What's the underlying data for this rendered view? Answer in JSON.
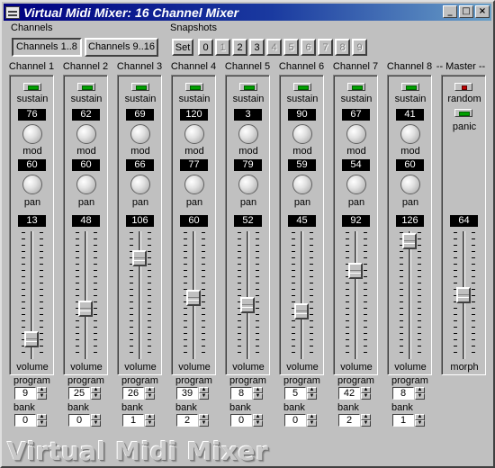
{
  "window": {
    "title": "Virtual Midi Mixer: 16 Channel Mixer",
    "minimize_glyph": "_",
    "maximize_glyph": "□",
    "close_glyph": "×"
  },
  "channels_group": {
    "label": "Channels",
    "buttons": [
      "Channels 1..8",
      "Channels 9..16"
    ]
  },
  "snapshots_group": {
    "label": "Snapshots",
    "set_label": "Set",
    "buttons": [
      "0",
      "1",
      "2",
      "3",
      "4",
      "5",
      "6",
      "7",
      "8",
      "9"
    ],
    "enabled": [
      true,
      false,
      true,
      true,
      false,
      false,
      false,
      false,
      false,
      false
    ]
  },
  "strip_labels": {
    "sustain": "sustain",
    "mod": "mod",
    "pan": "pan",
    "volume": "volume",
    "program": "program",
    "bank": "bank"
  },
  "channels": [
    {
      "name": "Channel 1",
      "sustain_val": "76",
      "mod_val": "60",
      "pan_val": "13",
      "volume": 13,
      "program": "9",
      "bank": "0"
    },
    {
      "name": "Channel 2",
      "sustain_val": "62",
      "mod_val": "60",
      "pan_val": "48",
      "volume": 48,
      "program": "25",
      "bank": "0"
    },
    {
      "name": "Channel 3",
      "sustain_val": "69",
      "mod_val": "66",
      "pan_val": "106",
      "volume": 106,
      "program": "26",
      "bank": "1"
    },
    {
      "name": "Channel 4",
      "sustain_val": "120",
      "mod_val": "77",
      "pan_val": "60",
      "volume": 60,
      "program": "39",
      "bank": "2"
    },
    {
      "name": "Channel 5",
      "sustain_val": "3",
      "mod_val": "79",
      "pan_val": "52",
      "volume": 52,
      "program": "8",
      "bank": "0"
    },
    {
      "name": "Channel 6",
      "sustain_val": "90",
      "mod_val": "59",
      "pan_val": "45",
      "volume": 45,
      "program": "5",
      "bank": "0"
    },
    {
      "name": "Channel 7",
      "sustain_val": "67",
      "mod_val": "54",
      "pan_val": "92",
      "volume": 92,
      "program": "42",
      "bank": "2"
    },
    {
      "name": "Channel 8",
      "sustain_val": "41",
      "mod_val": "60",
      "pan_val": "126",
      "volume": 126,
      "program": "8",
      "bank": "1"
    }
  ],
  "master": {
    "name": "-- Master --",
    "random_label": "random",
    "panic_label": "panic",
    "morph_val": "64",
    "morph": 64,
    "morph_label": "morph"
  },
  "logo_text": "Virtual Midi Mixer",
  "colors": {
    "title_start": "#000080",
    "title_end": "#6aa0c8",
    "led_green": "#00a000",
    "led_red": "#c00000",
    "face": "#c0c0c0"
  }
}
